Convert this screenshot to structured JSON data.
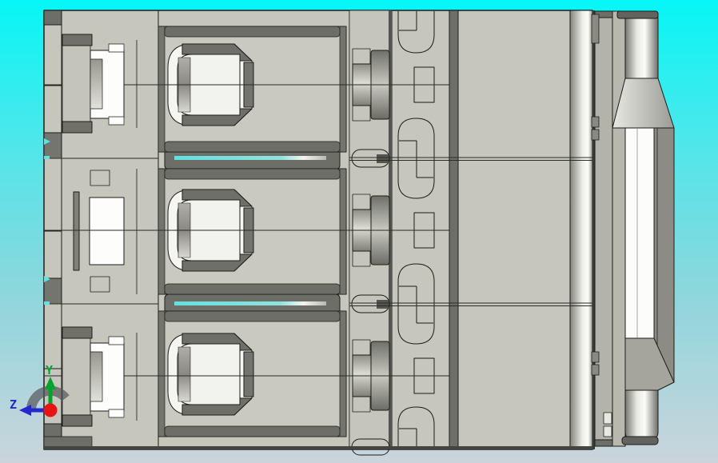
{
  "scene": {
    "description": "CAD viewport - side (Z-Y plane) view of a 3-pole molded-case breaker style part",
    "section_count": "3"
  },
  "viewport": {
    "bg_top": "#06F6F6",
    "bg_mid": "#8BD7DC",
    "bg_bottom": "#CBD4DB"
  },
  "model": {
    "body_color": "#C6C6BD",
    "panel_color": "#C9C9C0",
    "recess_color": "#6E6E68",
    "strip_color": "#74746E",
    "highlight_color": "#FCFCFA",
    "outline_color": "#1C1C1A"
  },
  "axis_triad": {
    "y": {
      "label": "Y",
      "color": "#00A32B"
    },
    "z": {
      "label": "Z",
      "color": "#2428CE"
    },
    "origin_color": "#E81313",
    "arc_color": "#55555A"
  }
}
